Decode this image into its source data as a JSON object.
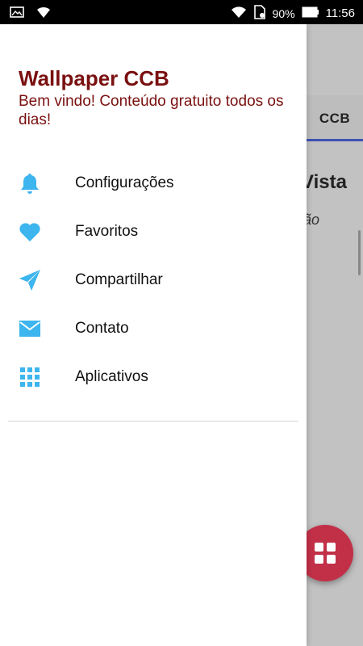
{
  "status_bar": {
    "battery_percent": "90%",
    "time": "11:56"
  },
  "background_app": {
    "tab_label": "CCB",
    "heading_partial": "Vista",
    "sub_partial": "ão"
  },
  "drawer": {
    "title": "Wallpaper CCB",
    "subtitle": "Bem vindo! Conteúdo gratuito todos os dias!",
    "items": [
      {
        "label": "Configurações",
        "icon": "bell-icon"
      },
      {
        "label": "Favoritos",
        "icon": "heart-icon"
      },
      {
        "label": "Compartilhar",
        "icon": "send-icon"
      },
      {
        "label": "Contato",
        "icon": "mail-icon"
      },
      {
        "label": "Aplicativos",
        "icon": "apps-grid-icon"
      }
    ]
  },
  "colors": {
    "accent_icon": "#3db5ee",
    "title": "#7a1010",
    "fab": "#c23048"
  }
}
